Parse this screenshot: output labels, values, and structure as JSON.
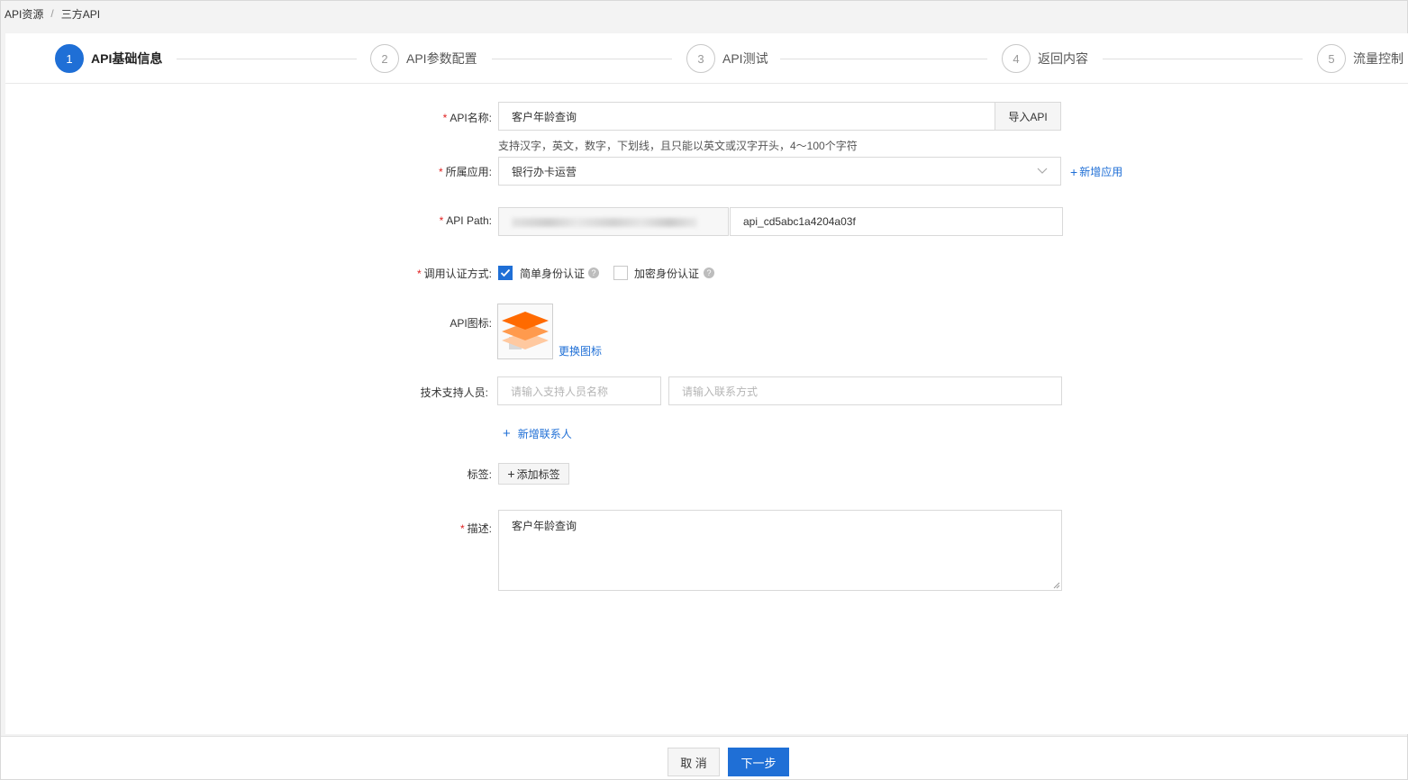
{
  "breadcrumb": {
    "root": "API资源",
    "separator": "/",
    "current": "三方API"
  },
  "steps": [
    {
      "num": "1",
      "label": "API基础信息"
    },
    {
      "num": "2",
      "label": "API参数配置"
    },
    {
      "num": "3",
      "label": "API测试"
    },
    {
      "num": "4",
      "label": "返回内容"
    },
    {
      "num": "5",
      "label": "流量控制"
    }
  ],
  "active_step": 1,
  "form": {
    "required_mark": "*",
    "api_name": {
      "label": "API名称:",
      "value": "客户年龄查询",
      "import_button": "导入API",
      "hint": "支持汉字，英文，数字，下划线，且只能以英文或汉字开头，4～100个字符"
    },
    "app": {
      "label": "所属应用:",
      "value": "银行办卡运营",
      "add_link": "新增应用"
    },
    "api_path": {
      "label": "API Path:",
      "suffix": "api_cd5abc1a4204a03f"
    },
    "auth": {
      "label": "调用认证方式:",
      "option1": "简单身份认证",
      "option1_checked": true,
      "option2": "加密身份认证",
      "option2_checked": false
    },
    "icon": {
      "label": "API图标:",
      "change_link": "更换图标"
    },
    "support": {
      "label": "技术支持人员:",
      "name_placeholder": "请输入支持人员名称",
      "contact_placeholder": "请输入联系方式",
      "add_contact": "新增联系人"
    },
    "tags": {
      "label": "标签:",
      "add_button": "添加标签"
    },
    "description": {
      "label": "描述:",
      "value": "客户年龄查询"
    }
  },
  "footer": {
    "cancel": "取 消",
    "next": "下一步"
  },
  "colors": {
    "primary": "#1f6fd6",
    "required": "#e02020",
    "icon_orange": "#ff6a00"
  }
}
